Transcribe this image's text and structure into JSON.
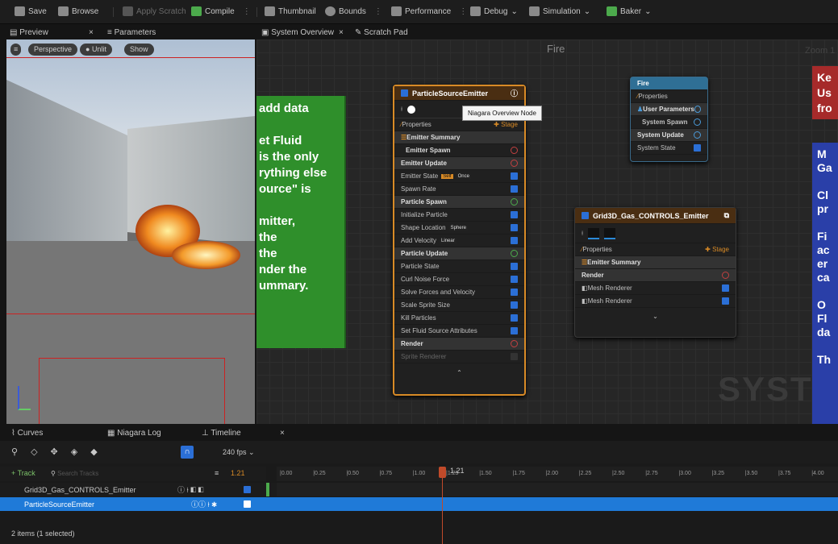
{
  "toolbar": {
    "save": "Save",
    "browse": "Browse",
    "apply_scratch": "Apply Scratch",
    "compile": "Compile",
    "thumbnail": "Thumbnail",
    "bounds": "Bounds",
    "performance": "Performance",
    "debug": "Debug",
    "simulation": "Simulation",
    "baker": "Baker"
  },
  "left_tabs": {
    "preview": "Preview",
    "close": "×",
    "parameters": "Parameters"
  },
  "graph_tabs": {
    "system_overview": "System Overview",
    "close": "×",
    "scratch_pad": "Scratch Pad"
  },
  "viewport": {
    "perspective": "Perspective",
    "unlit": "Unlit",
    "show": "Show"
  },
  "graph": {
    "title": "Fire",
    "zoom": "Zoom 1",
    "watermark": "SYSTEM",
    "tooltip": "Niagara Overview Node"
  },
  "comment_left": [
    "add data",
    "",
    "et Fluid",
    "is the only",
    "rything else",
    "ource\" is",
    "",
    "mitter,",
    "the",
    "the",
    "nder the",
    "ummary."
  ],
  "comment_right": [
    "Ke",
    "Us",
    "fro"
  ],
  "comment_right2": [
    "M",
    "Ga",
    "",
    "Cl",
    "pr",
    "",
    "Fi",
    "ac",
    "er",
    "ca",
    "",
    "O",
    "Fl",
    "da",
    "",
    "Th"
  ],
  "pse": {
    "title": "ParticleSourceEmitter",
    "properties": "Properties",
    "stage": "Stage",
    "emitter_summary": "Emitter Summary",
    "emitter_spawn": "Emitter Spawn",
    "emitter_update": "Emitter Update",
    "emitter_state": "Emitter State",
    "self": "Self",
    "once": "Once",
    "spawn_rate": "Spawn Rate",
    "particle_spawn": "Particle Spawn",
    "initialize_particle": "Initialize Particle",
    "shape_location": "Shape Location",
    "sphere": "Sphere",
    "add_velocity": "Add Velocity",
    "linear": "Linear",
    "particle_update": "Particle Update",
    "particle_state": "Particle State",
    "curl_noise": "Curl Noise Force",
    "solve_forces": "Solve Forces and Velocity",
    "scale_sprite": "Scale Sprite Size",
    "kill_particles": "Kill Particles",
    "set_fluid": "Set Fluid Source Attributes",
    "render": "Render",
    "sprite_renderer": "Sprite Renderer"
  },
  "fire": {
    "title": "Fire",
    "properties": "Properties",
    "user_params": "User Parameters",
    "system_spawn": "System Spawn",
    "system_update": "System Update",
    "system_state": "System State"
  },
  "grid": {
    "title": "Grid3D_Gas_CONTROLS_Emitter",
    "properties": "Properties",
    "stage": "Stage",
    "emitter_summary": "Emitter Summary",
    "render": "Render",
    "mesh1": "Mesh Renderer",
    "mesh2": "Mesh Renderer"
  },
  "bottom_tabs": {
    "curves": "Curves",
    "niagara_log": "Niagara Log",
    "timeline": "Timeline",
    "close": "×"
  },
  "timeline": {
    "fps": "240 fps",
    "add_track": "+ Track",
    "search": "Search Tracks",
    "time_value": "1.21",
    "playhead": "1.21",
    "ticks": [
      "0.00",
      "0.25",
      "0.50",
      "0.75",
      "1.00",
      "1.25",
      "1.50",
      "1.75",
      "2.00",
      "2.25",
      "2.50",
      "2.75",
      "3.00",
      "3.25",
      "3.50",
      "3.75",
      "4.00"
    ],
    "tracks": [
      "Grid3D_Gas_CONTROLS_Emitter",
      "ParticleSourceEmitter"
    ],
    "status": "2 items (1 selected)"
  },
  "colors": {
    "accent": "#2b6fd6",
    "selected_track": "#1f7ad8",
    "node_orange": "#d88a26",
    "comment_green": "#2f8f2b",
    "comment_blue": "#2a3fa8",
    "playhead": "#c04a2a"
  }
}
